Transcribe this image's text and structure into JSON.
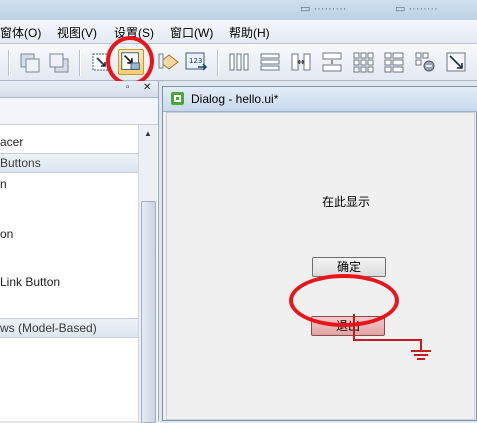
{
  "menubar": {
    "items": [
      "窗体(O)",
      "视图(V)",
      "设置(S)",
      "窗口(W)",
      "帮助(H)"
    ]
  },
  "toolbar": {
    "buttons": [
      {
        "icon": "bring-to-front-icon"
      },
      {
        "icon": "send-to-back-icon"
      },
      {
        "icon": "edit-widgets-icon"
      },
      {
        "icon": "edit-signals-slots-icon",
        "active": true
      },
      {
        "icon": "edit-buddies-icon"
      },
      {
        "icon": "edit-tab-order-icon"
      },
      {
        "icon": "layout-horizontal-icon"
      },
      {
        "icon": "layout-vertical-icon"
      },
      {
        "icon": "layout-horizontal-splitter-icon"
      },
      {
        "icon": "layout-vertical-splitter-icon"
      },
      {
        "icon": "layout-grid-icon"
      },
      {
        "icon": "layout-form-icon"
      },
      {
        "icon": "break-layout-icon"
      },
      {
        "icon": "adjust-size-icon"
      }
    ]
  },
  "widget_box": {
    "items": [
      {
        "text": "acer",
        "type": "row"
      },
      {
        "text": "Buttons",
        "type": "category"
      },
      {
        "text": "n",
        "type": "row"
      },
      {
        "text": "on",
        "type": "row"
      },
      {
        "text": "Link Button",
        "type": "row"
      },
      {
        "text": "ws (Model-Based)",
        "type": "category"
      }
    ]
  },
  "dialog": {
    "title": "Dialog - hello.ui*",
    "label": "在此显示",
    "ok_button": "确定",
    "exit_button": "退出"
  },
  "colors": {
    "annotation_red": "#e8151b",
    "connection_red": "#c41d1d"
  }
}
